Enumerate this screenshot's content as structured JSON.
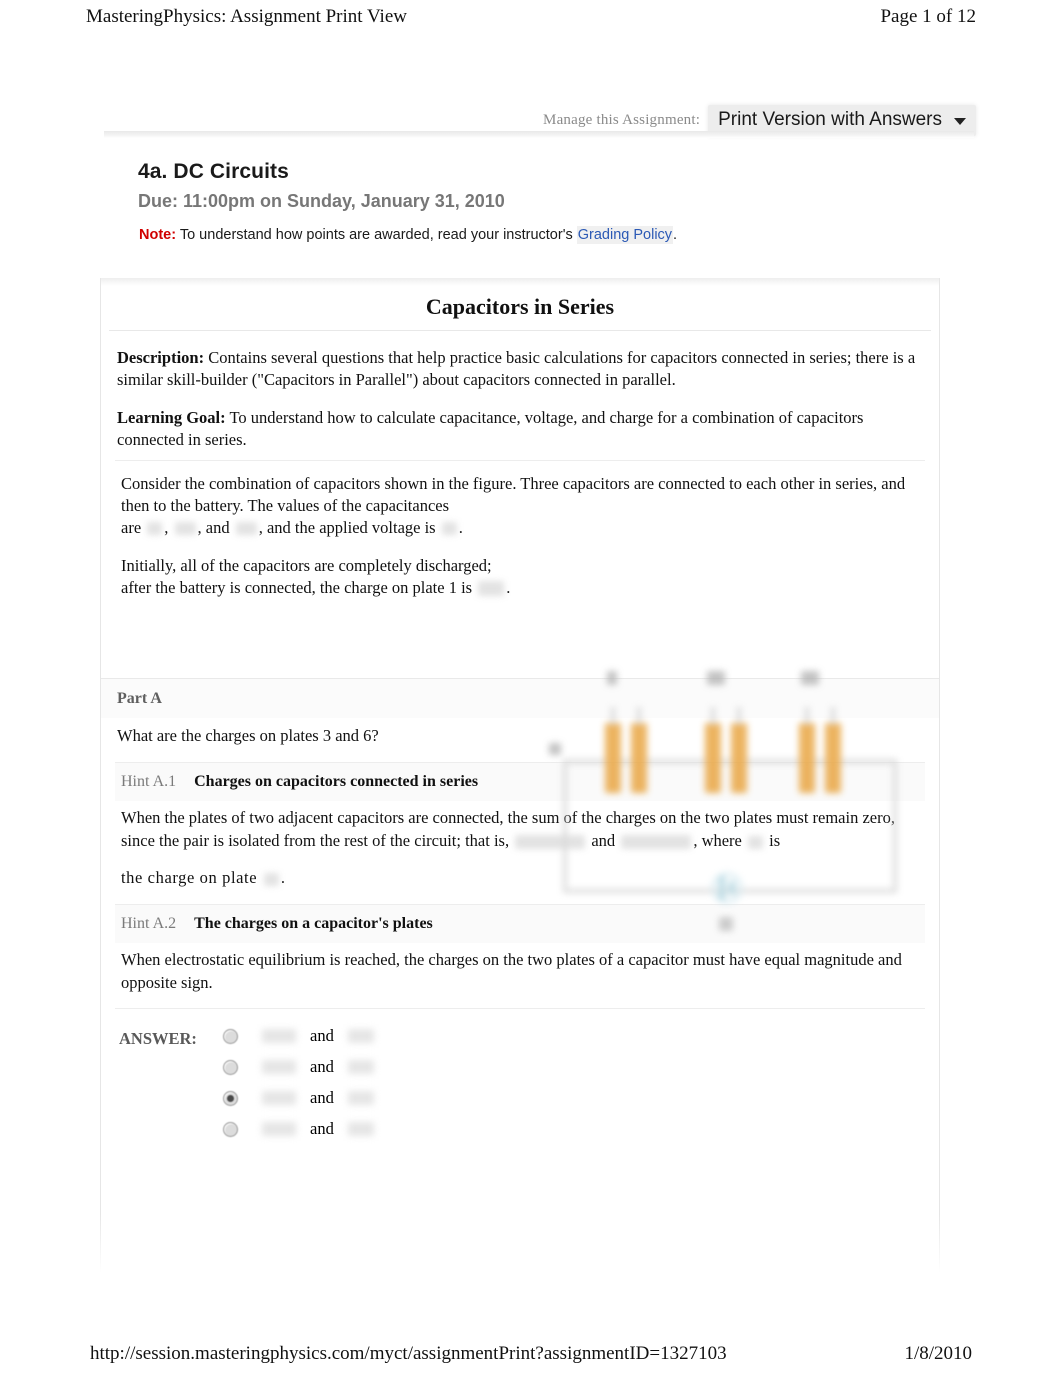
{
  "print_header": {
    "left": "MasteringPhysics: Assignment Print View",
    "right": "Page 1 of 12"
  },
  "print_footer": {
    "url": "http://session.masteringphysics.com/myct/assignmentPrint?assignmentID=1327103",
    "date": "1/8/2010"
  },
  "manage": {
    "label": "Manage this Assignment:",
    "selected_option": "Print Version with Answers"
  },
  "assignment": {
    "title": "4a. DC Circuits",
    "due": "Due: 11:00pm on Sunday, January 31, 2010",
    "note_word": "Note:",
    "note_text": "To understand how points are awarded, read your instructor's",
    "note_link": "Grading Policy",
    "note_period": "."
  },
  "problem": {
    "title": "Capacitors in Series",
    "description_label": "Description:",
    "description_text": "Contains several questions that help practice basic calculations for capacitors connected in series; there is a similar skill-builder (\"Capacitors in Parallel\") about capacitors connected in parallel.",
    "goal_label": "Learning Goal:",
    "goal_text": "To understand how to calculate capacitance, voltage, and charge for a combination of capacitors connected in series.",
    "intro_1": "Consider the combination of capacitors shown in the figure. Three capacitors are connected to each other in series, and then to the battery. The values of the capacitances",
    "intro_2a": "are",
    "intro_2b": ",",
    "intro_2c": ", and",
    "intro_2d": ", and the applied voltage is",
    "intro_2e": ".",
    "intro_3a": "Initially, all of the capacitors are completely discharged;",
    "intro_3b": "after the battery is connected, the charge on plate 1 is",
    "intro_3c": "."
  },
  "part_a": {
    "heading": "Part A",
    "question": "What are the charges on plates 3 and 6?",
    "hints": [
      {
        "tag": "Hint A.1",
        "title": "Charges on capacitors connected in series",
        "body_a": "When the plates of two adjacent capacitors are connected, the sum of the charges on the two plates must remain zero, since the pair is isolated from the rest of the circuit; that is,",
        "body_and": "and",
        "body_b": ", where",
        "body_c": "is",
        "body_d": "the  charge  on  plate",
        "body_e": "."
      },
      {
        "tag": "Hint A.2",
        "title": "The charges on a capacitor's plates",
        "body_a": "When electrostatic equilibrium is reached, the charges on the two plates of a capacitor must have equal magnitude and opposite sign.",
        "body_and": "",
        "body_b": "",
        "body_c": "",
        "body_d": "",
        "body_e": ""
      }
    ],
    "answer_label": "ANSWER:",
    "answer_conjunction": "and",
    "answer_options": [
      {
        "selected": false
      },
      {
        "selected": false
      },
      {
        "selected": true
      },
      {
        "selected": false
      }
    ]
  },
  "figure": {
    "name": "series-capacitor-circuit-diagram",
    "capacitor_color": "#e8a33d",
    "wire_color": "#d0d0d0",
    "battery_color": "#9ec9d6"
  },
  "colors": {
    "note_red": "#d00000",
    "link_blue": "#2b59b5",
    "muted_gray": "#777777"
  }
}
